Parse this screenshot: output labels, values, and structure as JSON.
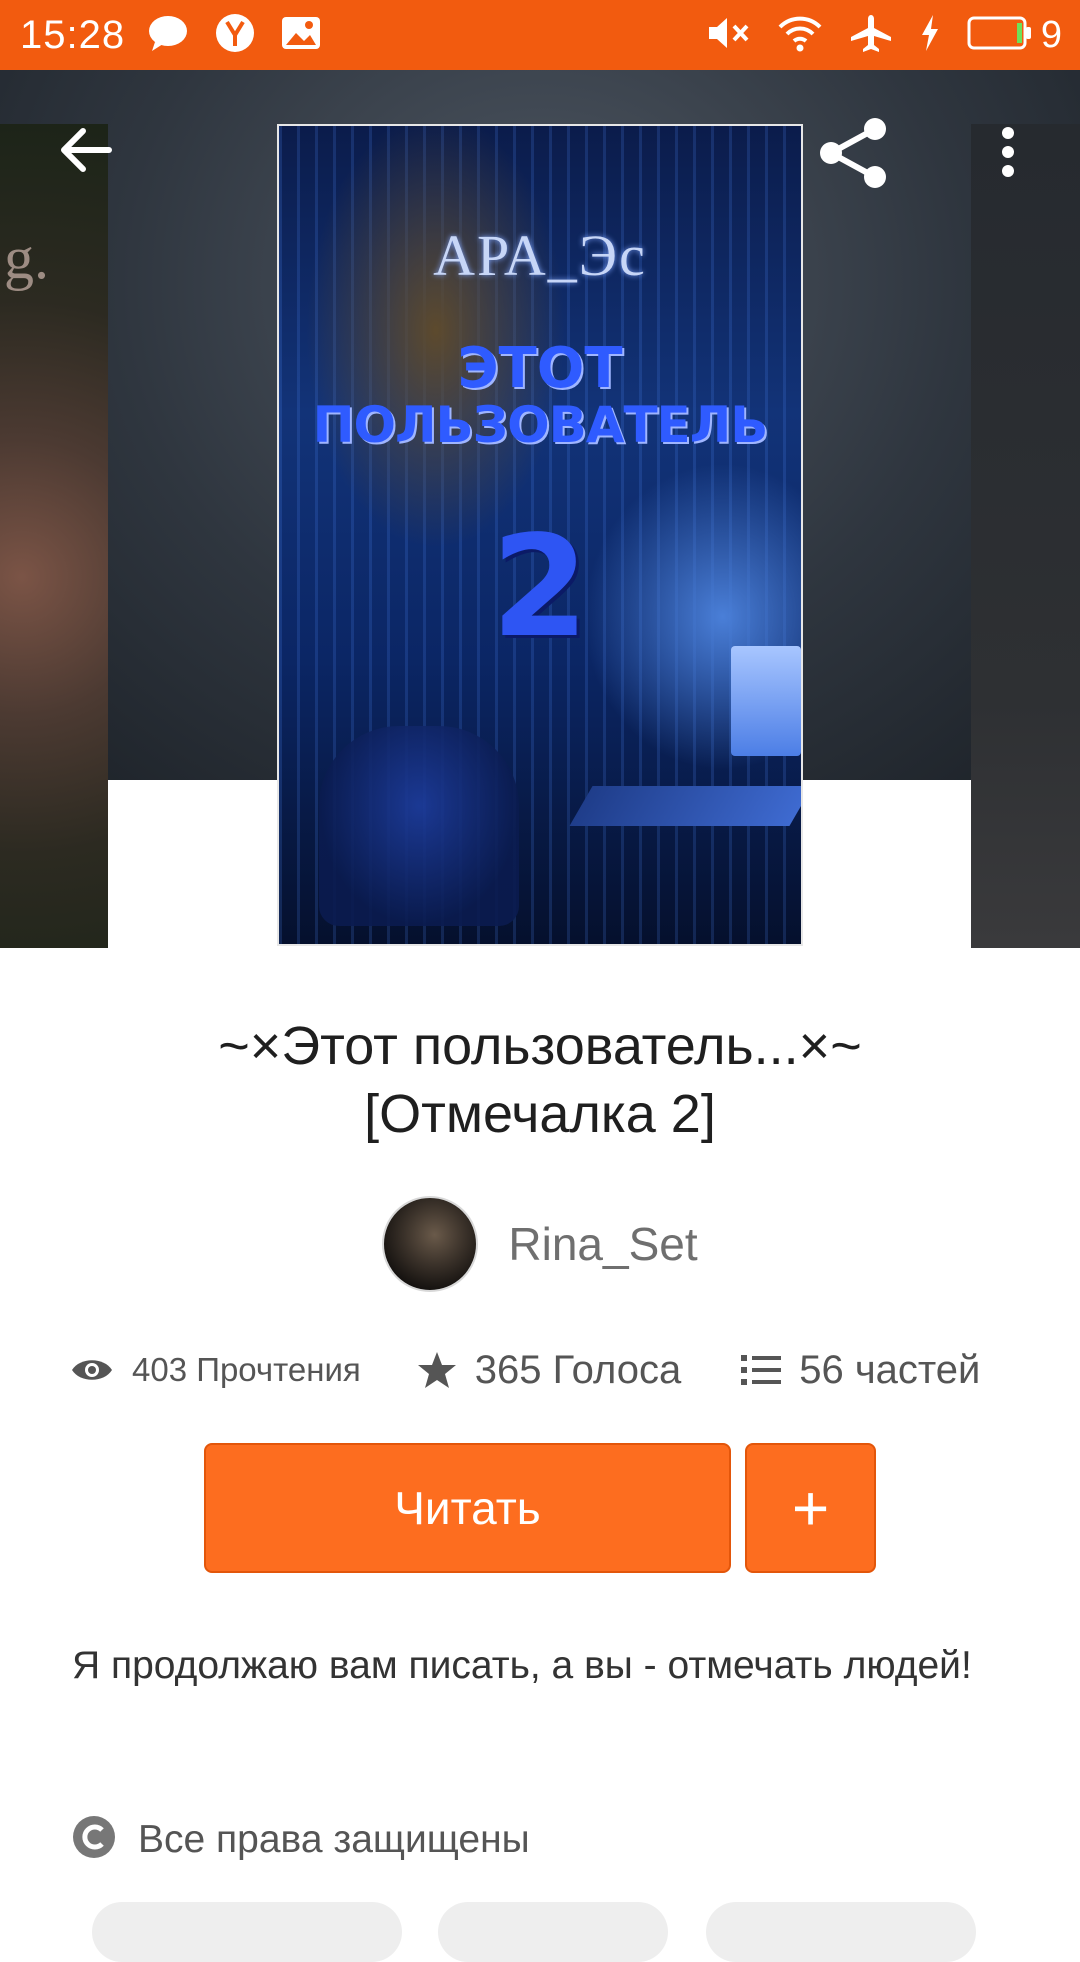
{
  "status_bar": {
    "time": "15:28",
    "battery_level": "9",
    "left_icons": [
      "message-icon",
      "yandex-icon",
      "image-notification-icon"
    ],
    "right_icons": [
      "mute-icon",
      "wifi-icon",
      "airplane-icon",
      "charging-icon",
      "battery-icon"
    ]
  },
  "toolbar": {
    "back_icon": "arrow-left-icon",
    "share_icon": "share-icon",
    "more_icon": "more-vertical-icon"
  },
  "cover": {
    "author_text": "АРА_Эс",
    "title_line1": "ЭТОТ",
    "title_line2": "ПОЛЬЗОВАТЕЛЬ",
    "number": "2"
  },
  "side_cover_left": {
    "text": "g."
  },
  "book": {
    "title_line1": "~×Этот пользователь...×~",
    "title_line2": "[Отмечалка 2]",
    "author": "Rina_Set"
  },
  "stats": {
    "reads": "403 Прочтения",
    "votes": "365 Голоса",
    "parts": "56 частей"
  },
  "actions": {
    "read_label": "Читать",
    "add_label": "+"
  },
  "description": "Я продолжаю вам писать, а вы - отмечать людей!",
  "copyright": "Все права защищены",
  "colors": {
    "brand_orange": "#fd6d1f",
    "status_bar": "#f25b0f"
  }
}
